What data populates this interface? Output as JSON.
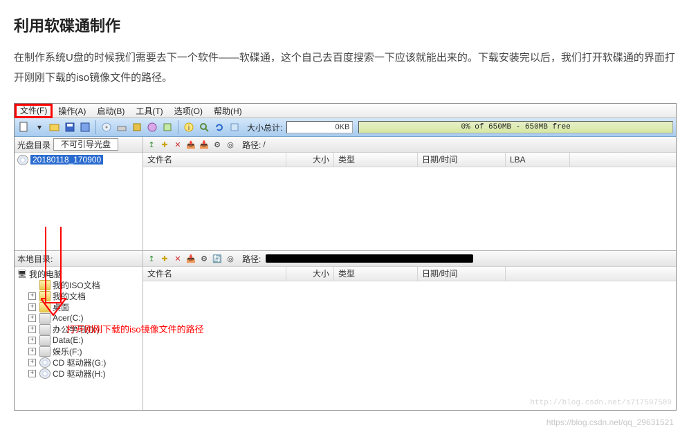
{
  "article": {
    "heading": "利用软碟通制作",
    "paragraph": "在制作系统U盘的时候我们需要去下一个软件——软碟通，这个自己去百度搜索一下应该就能出来的。下载安装完以后，我们打开软碟通的界面打开刚刚下载的iso镜像文件的路径。"
  },
  "menubar": {
    "items": [
      {
        "label": "文件(F)",
        "highlight": true
      },
      {
        "label": "操作(A)"
      },
      {
        "label": "启动(B)"
      },
      {
        "label": "工具(T)"
      },
      {
        "label": "选项(O)"
      },
      {
        "label": "帮助(H)"
      }
    ]
  },
  "toolbar": {
    "size_label": "大小总计:",
    "size_value": "0KB",
    "progress_text": "0% of 650MB - 650MB free"
  },
  "upper_left": {
    "title": "光盘目录",
    "boot_label": "不可引导光盘",
    "tree_root": "20180118_170900"
  },
  "upper_right": {
    "path_label": "路径:",
    "path_value": "/",
    "columns": {
      "name": "文件名",
      "size": "大小",
      "type": "类型",
      "date": "日期/时间",
      "lba": "LBA"
    }
  },
  "lower_left": {
    "title": "本地目录:",
    "tree": [
      {
        "label": "我的电脑",
        "icon": "computer",
        "root": true
      },
      {
        "label": "我的ISO文档",
        "icon": "folder"
      },
      {
        "label": "我的文档",
        "icon": "folder",
        "exp": "+"
      },
      {
        "label": "桌面",
        "icon": "folder",
        "exp": "+"
      },
      {
        "label": "Acer(C:)",
        "icon": "drive",
        "exp": "+"
      },
      {
        "label": "办公学习(D:)",
        "icon": "drive",
        "exp": "+"
      },
      {
        "label": "Data(E:)",
        "icon": "drive",
        "exp": "+"
      },
      {
        "label": "娱乐(F:)",
        "icon": "drive",
        "exp": "+"
      },
      {
        "label": "CD 驱动器(G:)",
        "icon": "cd",
        "exp": "+"
      },
      {
        "label": "CD 驱动器(H:)",
        "icon": "cd",
        "exp": "+"
      }
    ]
  },
  "lower_right": {
    "path_label": "路径:",
    "columns": {
      "name": "文件名",
      "size": "大小",
      "type": "类型",
      "date": "日期/时间"
    }
  },
  "annotation": "打开刚刚下载的iso镜像文件的路径",
  "watermark1": "http://blog.csdn.net/s717597589",
  "watermark2": "https://blog.csdn.net/qq_29631521"
}
